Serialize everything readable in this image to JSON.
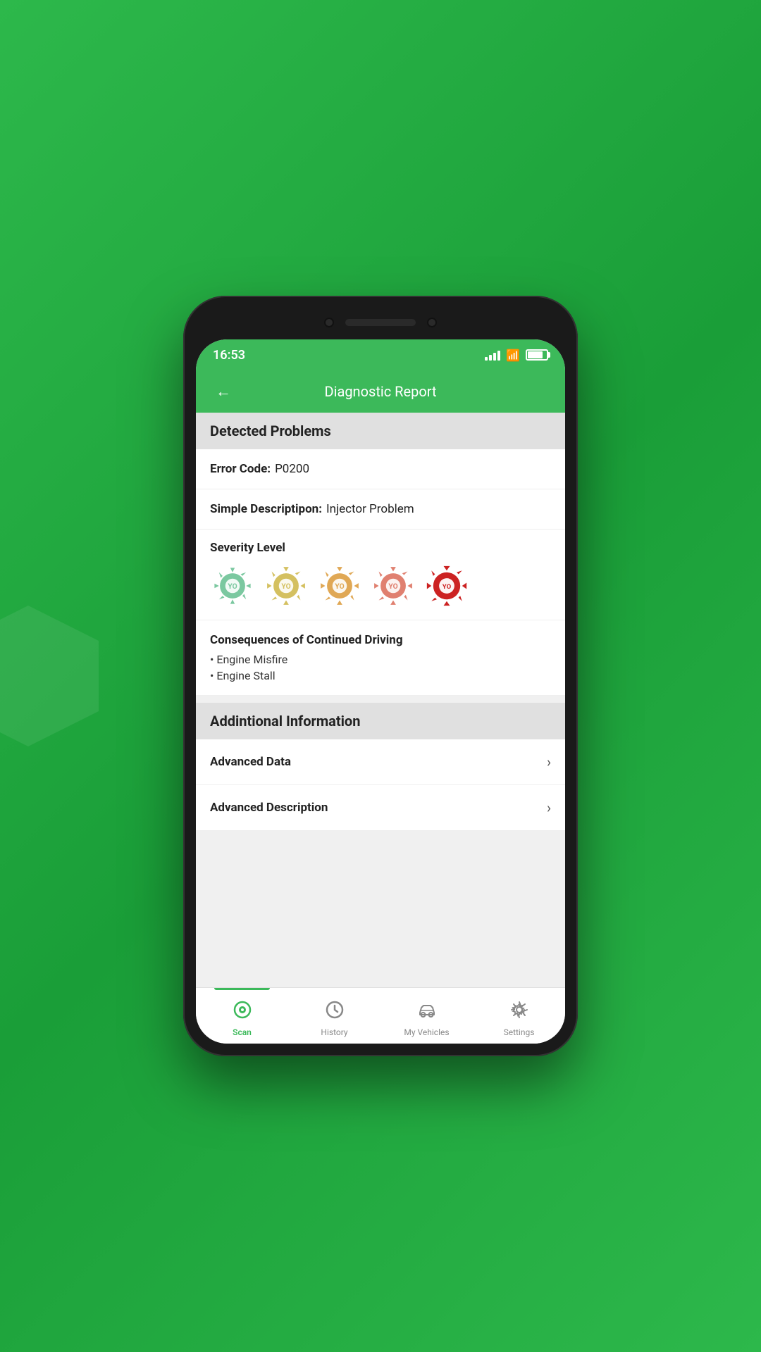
{
  "statusBar": {
    "time": "16:53"
  },
  "header": {
    "title": "Diagnostic Report",
    "backLabel": "←"
  },
  "detectedProblems": {
    "sectionTitle": "Detected Problems",
    "errorCodeLabel": "Error Code:",
    "errorCodeValue": "P0200",
    "simpleDescLabel": "Simple Descriptipon:",
    "simpleDescValue": "Injector Problem",
    "severityLabel": "Severity Level",
    "severityLevels": [
      {
        "color": "#7bc8a0",
        "level": 1
      },
      {
        "color": "#d4c060",
        "level": 2
      },
      {
        "color": "#e0a855",
        "level": 3
      },
      {
        "color": "#e08070",
        "level": 4
      },
      {
        "color": "#cc2222",
        "level": 5,
        "active": true
      }
    ],
    "consequencesTitle": "Consequences of Continued Driving",
    "consequences": [
      "Engine Misfire",
      "Engine Stall"
    ]
  },
  "additionalInfo": {
    "sectionTitle": "Addintional Information",
    "items": [
      {
        "label": "Advanced Data"
      },
      {
        "label": "Advanced Description"
      }
    ]
  },
  "bottomNav": {
    "items": [
      {
        "label": "Scan",
        "active": true
      },
      {
        "label": "History",
        "active": false
      },
      {
        "label": "My Vehicles",
        "active": false
      },
      {
        "label": "Settings",
        "active": false
      }
    ]
  }
}
